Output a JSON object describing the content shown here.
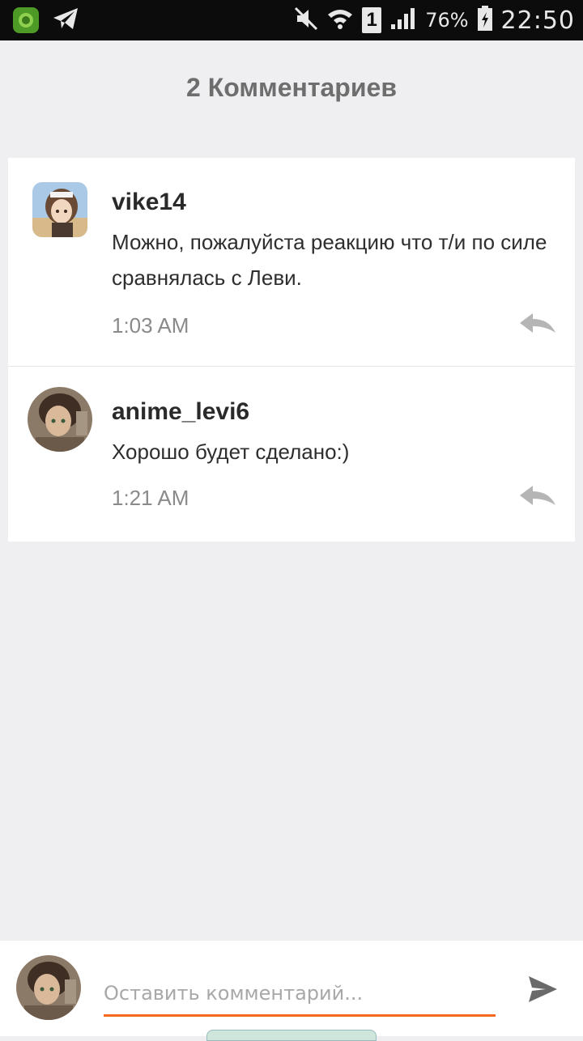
{
  "status_bar": {
    "notification_badge": "1",
    "battery_percent": "76%",
    "time": "22:50"
  },
  "header": {
    "title": "2 Комментариев"
  },
  "comments": [
    {
      "username": "vike14",
      "text": "Можно, пожалуйста реакцию что т/и по силе сравнялась с Леви.",
      "time": "1:03 AM"
    },
    {
      "username": "anime_levi6",
      "text": "Хорошо будет сделано:)",
      "time": "1:21 AM"
    }
  ],
  "composer": {
    "placeholder": "Оставить комментарий..."
  },
  "colors": {
    "accent": "#f26a1e",
    "background": "#efeef1",
    "status_bar": "#0c0c0c"
  }
}
